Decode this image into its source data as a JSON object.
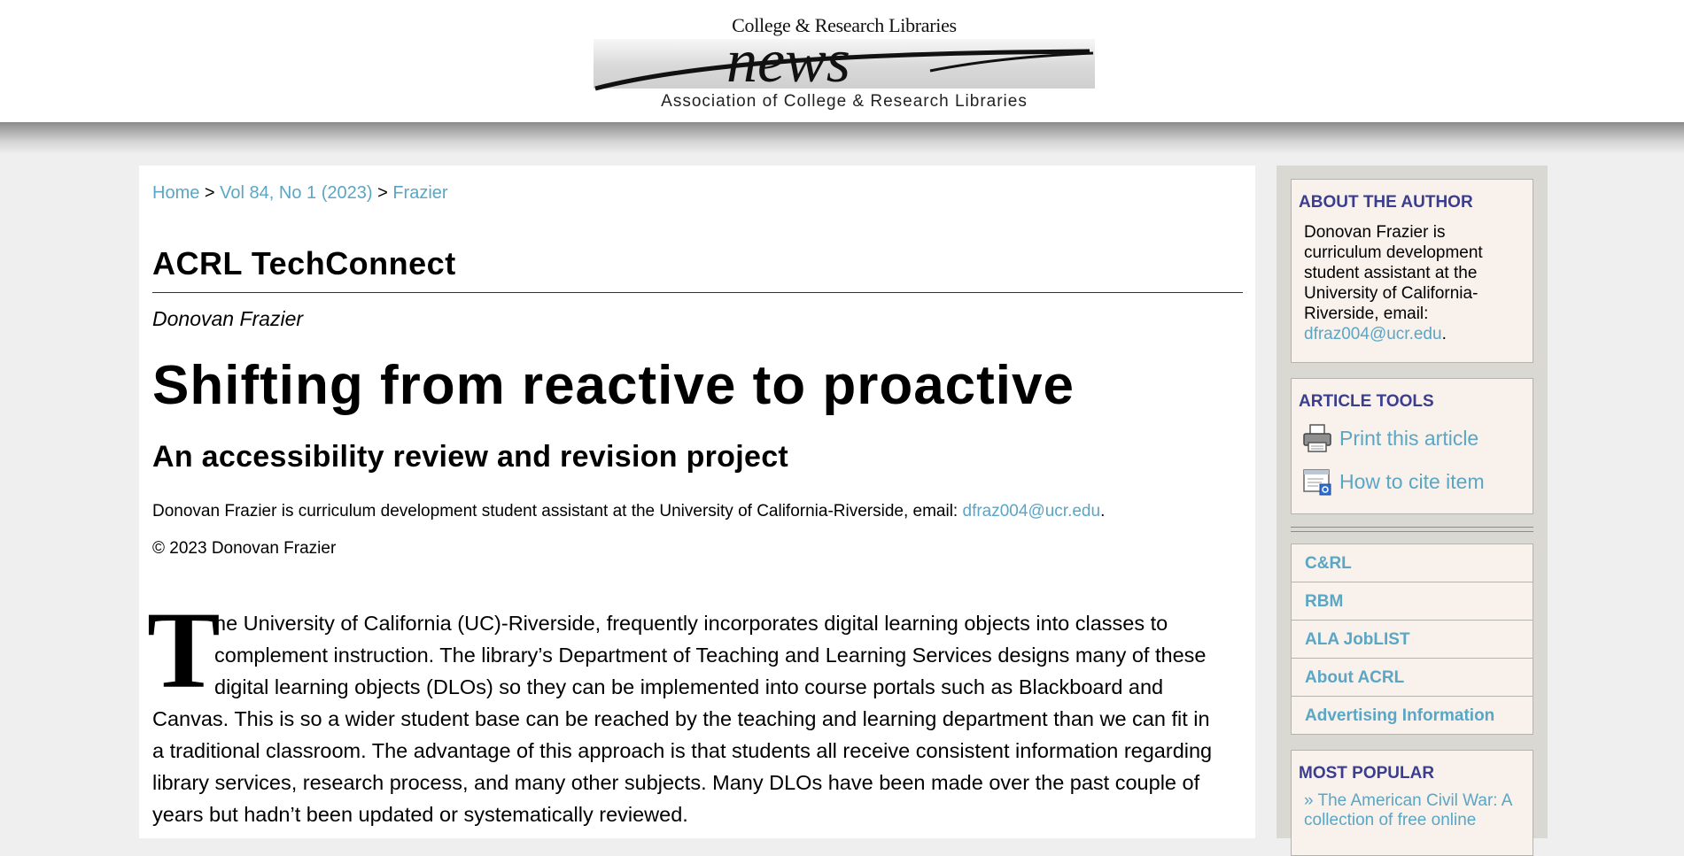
{
  "header": {
    "logo_top": "College & Research Libraries",
    "logo_middle": "news",
    "logo_bottom": "Association of College & Research Libraries"
  },
  "breadcrumb": {
    "home": "Home",
    "sep1": ">",
    "volume": "Vol 84, No 1 (2023)",
    "sep2": ">",
    "current": "Frazier"
  },
  "article": {
    "section": "ACRL TechConnect",
    "author": "Donovan Frazier",
    "title": "Shifting from reactive to proactive",
    "subtitle": "An accessibility review and revision project",
    "author_note_prefix": "Donovan Frazier is curriculum development student assistant at the University of California-Riverside, email:",
    "author_email": "dfraz004@ucr.edu",
    "author_note_suffix": ".",
    "copyright": "© 2023 Donovan Frazier",
    "dropcap": "T",
    "body_lines": [
      "he University of California (UC)-Riverside, frequently incorporates digital learning objects into classes to",
      "complement instruction. The library’s Department of Teaching and Learning Services designs many of these",
      "digital learning objects (DLOs) so they can be implemented into course portals such as Blackboard and",
      "Canvas. This is so a wider student base can be reached by the teaching and learning department than we can fit in",
      "a traditional classroom. The advantage of this approach is that students all receive consistent information regarding",
      "library services, research process, and many other subjects. Many DLOs have been made over the past couple of",
      "years but hadn’t been updated or systematically reviewed."
    ]
  },
  "sidebar": {
    "about": {
      "title": "ABOUT THE AUTHOR",
      "text": "Donovan Frazier is curriculum development student assistant at the University of California-Riverside, email:",
      "email": "dfraz004@ucr.edu",
      "suffix": "."
    },
    "tools": {
      "title": "ARTICLE TOOLS",
      "print_label": "Print this article",
      "print_icon": "printer-icon",
      "cite_label": "How to cite item",
      "cite_icon": "cite-icon"
    },
    "links": [
      "C&RL",
      "RBM",
      "ALA JobLIST",
      "About ACRL",
      "Advertising Information"
    ],
    "popular": {
      "title": "MOST POPULAR",
      "first_item": "» The American Civil War: A collection of free online"
    }
  },
  "colors": {
    "link": "#5aa6c4",
    "sidebar_title": "#3b3e8e",
    "sidebar_bg": "#dad8d2",
    "block_bg": "#f8f1ec",
    "page_bg": "#f0efef"
  }
}
